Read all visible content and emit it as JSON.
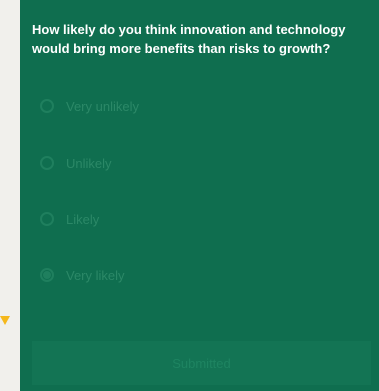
{
  "survey": {
    "question": "How likely do you think innovation and technology would bring more benefits than risks to growth?",
    "options": [
      {
        "label": "Very unlikely",
        "selected": false
      },
      {
        "label": "Unlikely",
        "selected": false
      },
      {
        "label": "Likely",
        "selected": false
      },
      {
        "label": "Very likely",
        "selected": true
      }
    ],
    "submit_label": "Submitted"
  },
  "colors": {
    "panel": "#0f6e4f",
    "accent_marker": "#f5b81c",
    "page_background": "#f1f0ec"
  }
}
